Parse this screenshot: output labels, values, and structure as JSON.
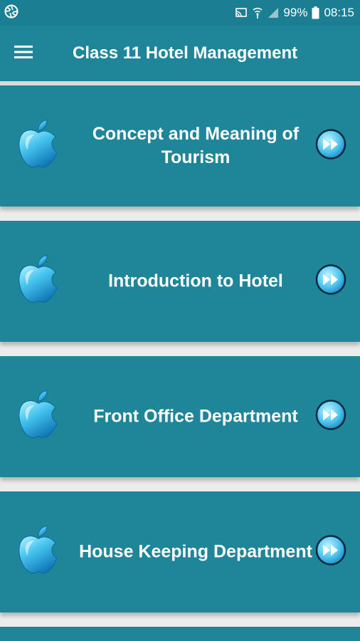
{
  "status_bar": {
    "battery": "99%",
    "time": "08:15",
    "icons": [
      "camera-aperture-icon",
      "cast-icon",
      "wifi-icon",
      "signal-icon",
      "battery-icon"
    ]
  },
  "app_bar": {
    "title": "Class 11 Hotel Management",
    "menu_icon": "hamburger-menu-icon"
  },
  "topics": [
    {
      "label": "Concept and Meaning of Tourism",
      "icon": "apple-icon",
      "action_icon": "fast-forward-icon"
    },
    {
      "label": "Introduction to Hotel",
      "icon": "apple-icon",
      "action_icon": "fast-forward-icon"
    },
    {
      "label": "Front Office Department",
      "icon": "apple-icon",
      "action_icon": "fast-forward-icon"
    },
    {
      "label": "House Keeping Department",
      "icon": "apple-icon",
      "action_icon": "fast-forward-icon"
    }
  ],
  "colors": {
    "status_bar": "#1b7e92",
    "app_bar": "#1f8599",
    "card": "#1f8599",
    "background": "#ececec"
  }
}
